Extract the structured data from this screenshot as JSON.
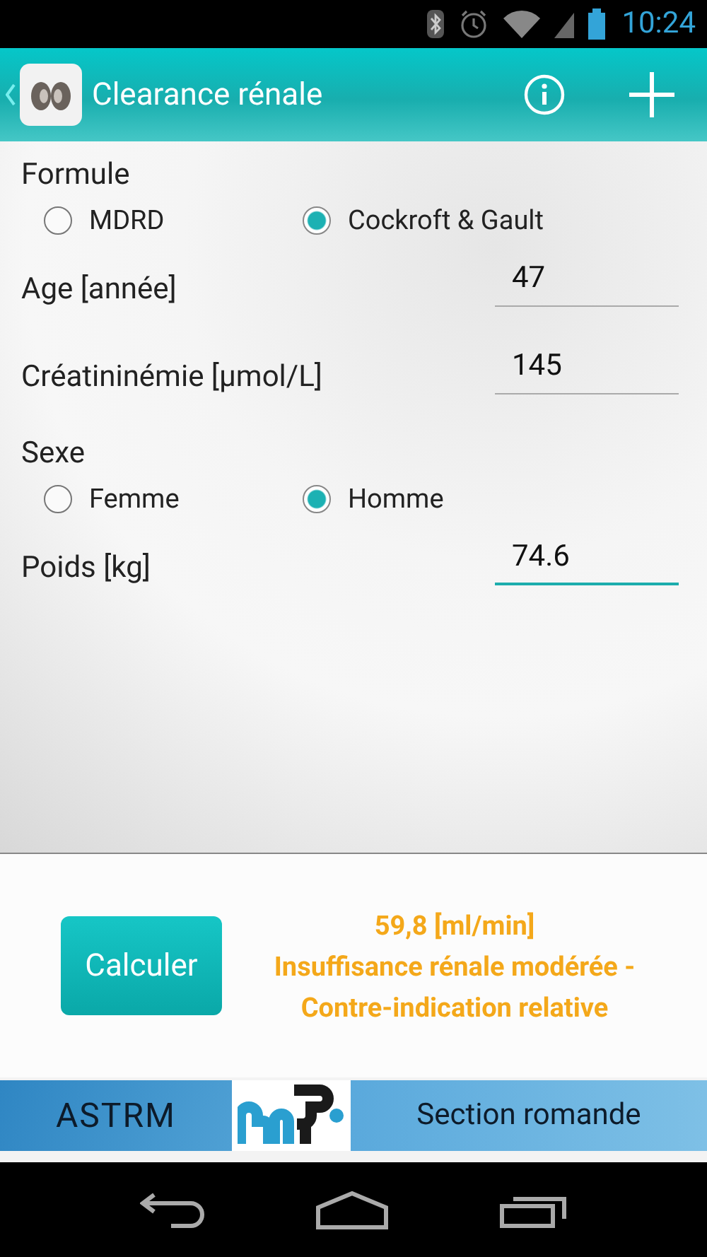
{
  "status_bar": {
    "time": "10:24"
  },
  "action_bar": {
    "title": "Clearance rénale"
  },
  "form": [
    {
      "kind": "radio",
      "label": "Formule",
      "options": [
        {
          "label": "MDRD",
          "selected": false
        },
        {
          "label": "Cockroft & Gault",
          "selected": true
        }
      ]
    },
    {
      "kind": "field",
      "label": "Age [année]",
      "value": "47",
      "focused": false
    },
    {
      "kind": "field",
      "label": "Créatininémie [µmol/L]",
      "value": "145",
      "focused": false
    },
    {
      "kind": "radio",
      "label": "Sexe",
      "options": [
        {
          "label": "Femme",
          "selected": false
        },
        {
          "label": "Homme",
          "selected": true
        }
      ]
    },
    {
      "kind": "field",
      "label": "Poids [kg]",
      "value": "74.6",
      "focused": true
    }
  ],
  "result_panel": {
    "button": "Calculer",
    "result": "59,8 [ml/min]\nInsuffisance rénale modérée - Contre-indication relative"
  },
  "banner": {
    "left": "ASTRM",
    "right": "Section romande"
  }
}
